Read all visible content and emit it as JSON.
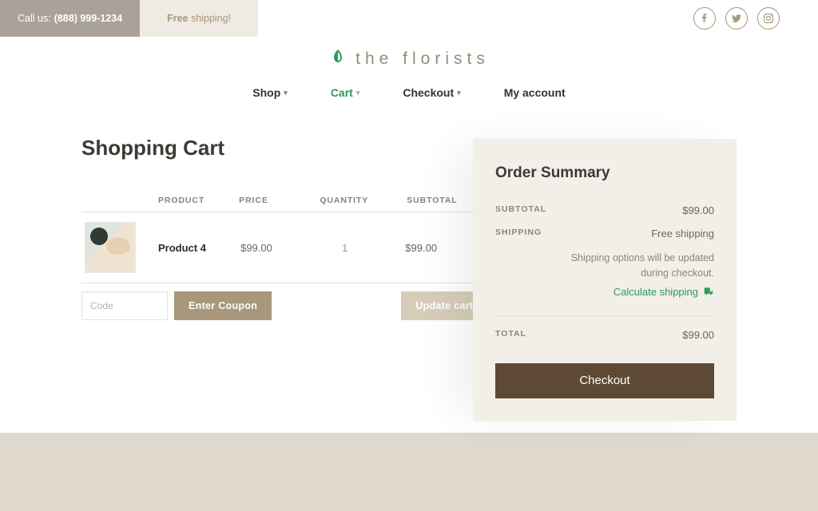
{
  "topbar": {
    "call_prefix": "Call us:",
    "call_number": "(888) 999-1234",
    "free_html": "Free",
    "free_suffix": " shipping!"
  },
  "brand": {
    "name": "the florists"
  },
  "nav": {
    "items": [
      {
        "label": "Shop",
        "active": false,
        "dropdown": true
      },
      {
        "label": "Cart",
        "active": true,
        "dropdown": true
      },
      {
        "label": "Checkout",
        "active": false,
        "dropdown": true
      },
      {
        "label": "My account",
        "active": false,
        "dropdown": false
      }
    ]
  },
  "page": {
    "title": "Shopping Cart"
  },
  "cart": {
    "headers": {
      "product": "PRODUCT",
      "price": "PRICE",
      "quantity": "QUANTITY",
      "subtotal": "SUBTOTAL"
    },
    "rows": [
      {
        "name": "Product 4",
        "price": "$99.00",
        "qty": "1",
        "subtotal": "$99.00"
      }
    ],
    "coupon_placeholder": "Code",
    "coupon_button": "Enter Coupon",
    "update_button": "Update cart"
  },
  "summary": {
    "title": "Order Summary",
    "subtotal_label": "SUBTOTAL",
    "subtotal_value": "$99.00",
    "shipping_label": "SHIPPING",
    "shipping_value": "Free shipping",
    "shipping_note_1": "Shipping options will be updated",
    "shipping_note_2": "during checkout.",
    "calc_label": "Calculate shipping",
    "total_label": "TOTAL",
    "total_value": "$99.00",
    "checkout_button": "Checkout"
  }
}
